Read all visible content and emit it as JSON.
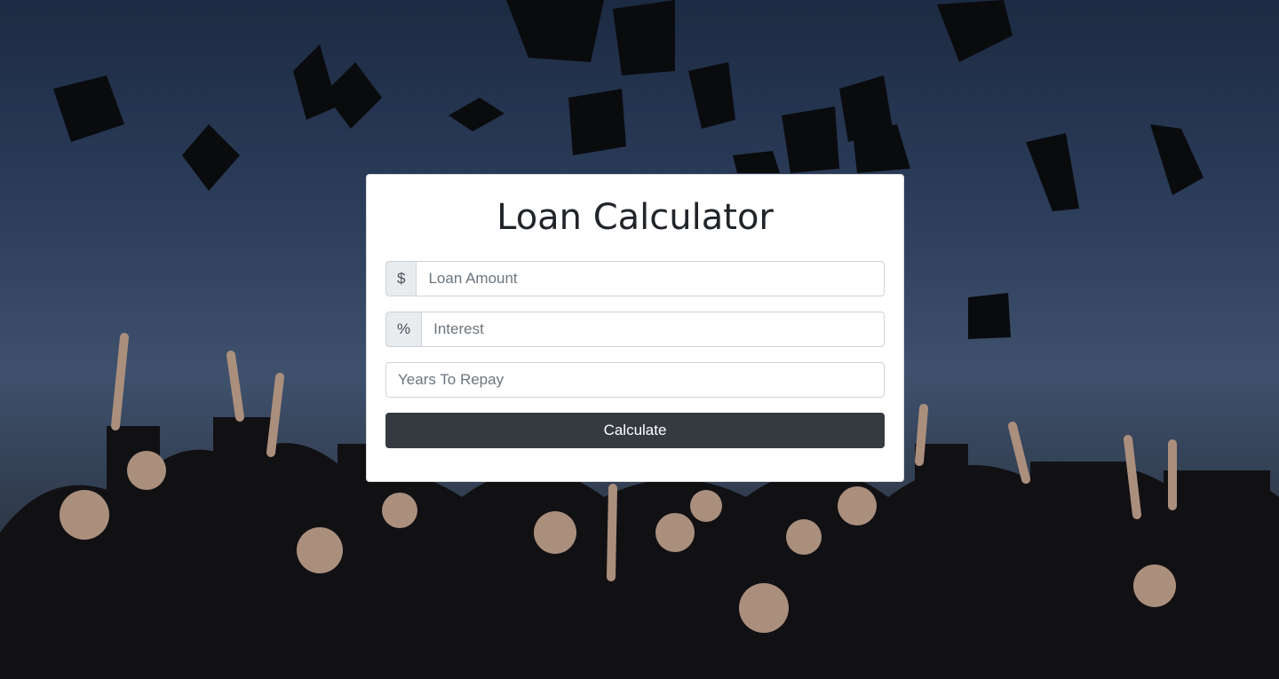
{
  "page": {
    "title": "Loan Calculator"
  },
  "form": {
    "amount": {
      "addon": "$",
      "placeholder": "Loan Amount",
      "value": ""
    },
    "interest": {
      "addon": "%",
      "placeholder": "Interest",
      "value": ""
    },
    "years": {
      "placeholder": "Years To Repay",
      "value": ""
    },
    "submit_label": "Calculate"
  },
  "colors": {
    "button": "#343a40",
    "card": "#ffffff",
    "addon": "#e9ecef"
  }
}
